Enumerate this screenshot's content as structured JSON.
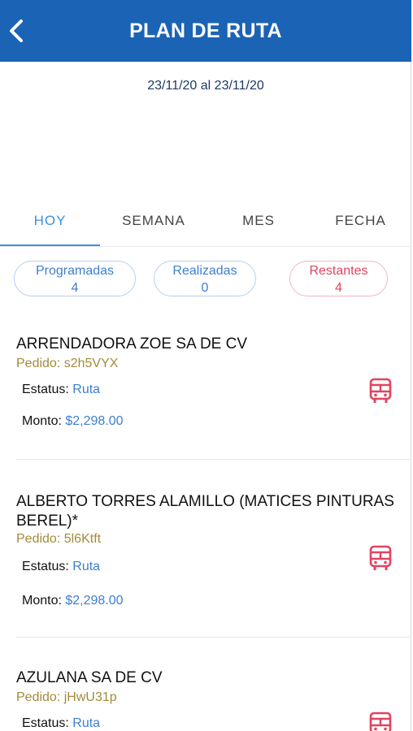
{
  "header": {
    "title": "PLAN DE RUTA",
    "back_icon": "chevron-left-icon"
  },
  "date_range": "23/11/20 al 23/11/20",
  "tabs": [
    {
      "label": "HOY",
      "active": true
    },
    {
      "label": "SEMANA",
      "active": false
    },
    {
      "label": "MES",
      "active": false
    },
    {
      "label": "FECHA",
      "active": false
    }
  ],
  "summary": {
    "programadas": {
      "label": "Programadas",
      "count": "4"
    },
    "realizadas": {
      "label": "Realizadas",
      "count": "0"
    },
    "restantes": {
      "label": "Restantes",
      "count": "4"
    }
  },
  "orders": [
    {
      "name": "ARRENDADORA ZOE SA DE CV",
      "pedido_label": "Pedido:",
      "pedido": "s2h5VYX",
      "estatus_label": "Estatus:",
      "estatus": "Ruta",
      "monto_label": "Monto:",
      "monto": "$2,298.00",
      "icon": "bus-icon"
    },
    {
      "name": "ALBERTO TORRES ALAMILLO (MATICES PINTURAS BEREL)*",
      "pedido_label": "Pedido:",
      "pedido": "5l6Ktft",
      "estatus_label": "Estatus:",
      "estatus": "Ruta",
      "monto_label": "Monto:",
      "monto": "$2,298.00",
      "icon": "bus-icon"
    },
    {
      "name": "AZULANA SA DE CV",
      "pedido_label": "Pedido:",
      "pedido": "jHwU31p",
      "estatus_label": "Estatus:",
      "estatus": "Ruta",
      "icon": "bus-icon"
    }
  ],
  "colors": {
    "header": "#1b63b5",
    "active_tab": "#3d8fe0",
    "pedido": "#a38a3c",
    "value": "#3d7fcf",
    "icon": "#e04460"
  }
}
